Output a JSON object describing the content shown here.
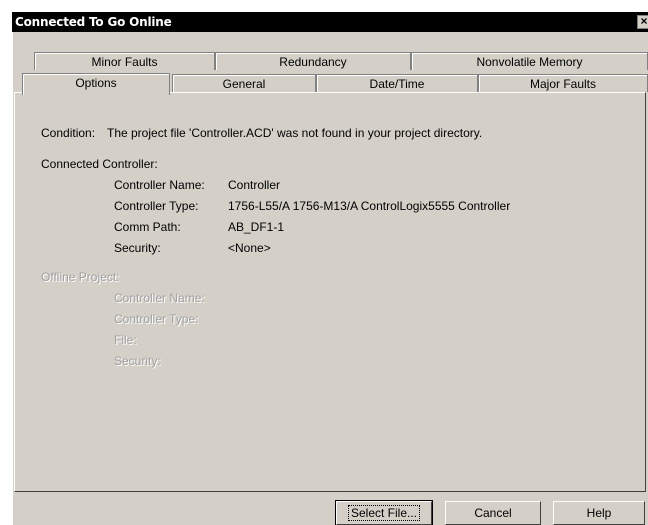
{
  "window": {
    "title": "Connected To Go Online",
    "close_glyph": "×"
  },
  "tabs": {
    "back_row": [
      "Minor Faults",
      "Redundancy",
      "Nonvolatile Memory"
    ],
    "front_row": [
      "Options",
      "General",
      "Date/Time",
      "Major Faults"
    ],
    "active": "Options"
  },
  "condition": {
    "label": "Condition:",
    "text": "The project file 'Controller.ACD' was not found in your project directory."
  },
  "connected": {
    "heading": "Connected Controller:",
    "name_label": "Controller Name:",
    "name_value": "Controller",
    "type_label": "Controller Type:",
    "type_value": "1756-L55/A 1756-M13/A ControlLogix5555 Controller",
    "path_label": "Comm Path:",
    "path_value": "AB_DF1-1",
    "security_label": "Security:",
    "security_value": "<None>"
  },
  "offline": {
    "heading": "Offline Project:",
    "name_label": "Controller Name:",
    "type_label": "Controller Type:",
    "file_label": "File:",
    "security_label": "Security:"
  },
  "buttons": {
    "select_file": "Select File...",
    "cancel": "Cancel",
    "help": "Help"
  }
}
